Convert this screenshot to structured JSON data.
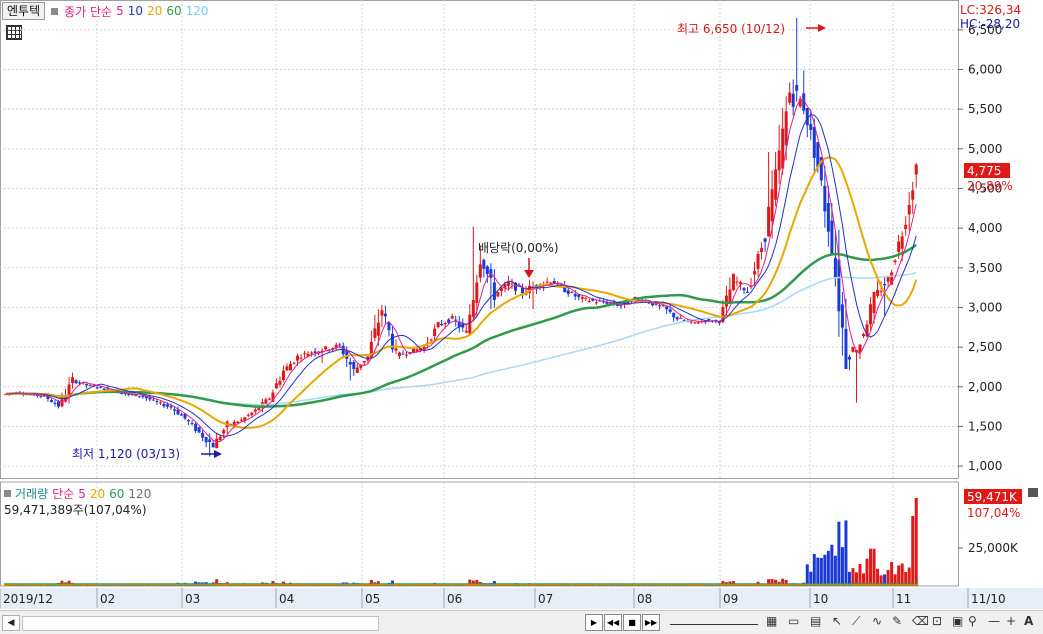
{
  "header": {
    "stock_name": "엔투텍",
    "ma_label": "종가 단순",
    "ma_periods": [
      "5",
      "10",
      "20",
      "60",
      "120"
    ],
    "ma_colors": [
      "#e0208c",
      "#2030c8",
      "#e8a800",
      "#2e9a4a",
      "#80c8f0"
    ]
  },
  "annotations": {
    "high": "최고 6,650 (10/12)",
    "low": "최저 1,120 (03/13)",
    "dividend": "배당락(0,00%)",
    "lc": "LC:326,34",
    "hc": "HC:-28,20",
    "price_tag": "4,775",
    "change_tag": "20,89%"
  },
  "volume_panel": {
    "title": "거래량",
    "ma_label": "단순",
    "ma_periods": [
      "5",
      "20",
      "60",
      "120"
    ],
    "ma_colors": [
      "#e0208c",
      "#e8a800",
      "#2e9a4a",
      "#707070"
    ],
    "value_text": "59,471,389주(107,04%)",
    "tag_value": "59,471K",
    "tag_pct": "107,04%",
    "axis_label": "25,000K"
  },
  "chart_data": {
    "type": "candlestick",
    "x_axis_labels": [
      "2019/12",
      "02",
      "03",
      "04",
      "05",
      "06",
      "07",
      "08",
      "09",
      "10",
      "11",
      "11/10"
    ],
    "y_ticks": [
      "1,000",
      "1,500",
      "2,000",
      "2,500",
      "3,000",
      "3,500",
      "4,000",
      "4,500",
      "5,000",
      "5,500",
      "6,000",
      "6,500"
    ],
    "y_range": [
      850,
      6750
    ],
    "ohlc_weekly_approx": [
      [
        1900,
        1960,
        1870,
        1930
      ],
      [
        1930,
        1980,
        1880,
        1900
      ],
      [
        1900,
        1950,
        1840,
        1880
      ],
      [
        1880,
        1920,
        1720,
        1760
      ],
      [
        1760,
        2180,
        1740,
        2080
      ],
      [
        2080,
        2120,
        1960,
        2020
      ],
      [
        2020,
        2060,
        1950,
        1990
      ],
      [
        1990,
        2020,
        1880,
        1940
      ],
      [
        1940,
        1980,
        1860,
        1900
      ],
      [
        1900,
        1950,
        1830,
        1880
      ],
      [
        1880,
        1920,
        1760,
        1800
      ],
      [
        1800,
        1850,
        1700,
        1740
      ],
      [
        1740,
        1780,
        1560,
        1600
      ],
      [
        1600,
        1640,
        1380,
        1420
      ],
      [
        1420,
        1460,
        1120,
        1260
      ],
      [
        1260,
        1580,
        1220,
        1520
      ],
      [
        1520,
        1640,
        1480,
        1580
      ],
      [
        1580,
        1760,
        1540,
        1700
      ],
      [
        1700,
        1900,
        1660,
        1860
      ],
      [
        1860,
        2280,
        1820,
        2200
      ],
      [
        2200,
        2420,
        2120,
        2380
      ],
      [
        2380,
        2500,
        2280,
        2440
      ],
      [
        2440,
        2560,
        2300,
        2480
      ],
      [
        2480,
        2600,
        2360,
        2520
      ],
      [
        2520,
        2560,
        2080,
        2200
      ],
      [
        2200,
        2420,
        2160,
        2380
      ],
      [
        2380,
        3080,
        2340,
        2980
      ],
      [
        2980,
        3050,
        2340,
        2400
      ],
      [
        2400,
        2520,
        2320,
        2440
      ],
      [
        2440,
        2560,
        2360,
        2500
      ],
      [
        2500,
        2820,
        2460,
        2780
      ],
      [
        2780,
        2920,
        2660,
        2860
      ],
      [
        2860,
        2960,
        2600,
        2680
      ],
      [
        2680,
        4020,
        2640,
        3680
      ],
      [
        3680,
        3720,
        2980,
        3160
      ],
      [
        3160,
        3400,
        3060,
        3300
      ],
      [
        3300,
        3420,
        3100,
        3200
      ],
      [
        3200,
        3360,
        2980,
        3280
      ],
      [
        3280,
        3400,
        3120,
        3340
      ],
      [
        3340,
        3420,
        3160,
        3220
      ],
      [
        3220,
        3300,
        3060,
        3120
      ],
      [
        3120,
        3200,
        3000,
        3080
      ],
      [
        3080,
        3160,
        2980,
        3060
      ],
      [
        3060,
        3120,
        2960,
        3020
      ],
      [
        3020,
        3180,
        2980,
        3120
      ],
      [
        3120,
        3160,
        3020,
        3060
      ],
      [
        3060,
        3140,
        2920,
        3000
      ],
      [
        3000,
        3060,
        2800,
        2860
      ],
      [
        2860,
        2940,
        2720,
        2800
      ],
      [
        2800,
        2880,
        2740,
        2840
      ],
      [
        2840,
        2900,
        2760,
        2820
      ],
      [
        2820,
        3420,
        2800,
        3360
      ],
      [
        3360,
        3460,
        3120,
        3200
      ],
      [
        3200,
        3820,
        3180,
        3760
      ],
      [
        3760,
        4960,
        3700,
        4620
      ],
      [
        4620,
        5960,
        4560,
        5720
      ],
      [
        5720,
        6650,
        5420,
        5560
      ],
      [
        5560,
        5600,
        4700,
        4780
      ],
      [
        4780,
        4820,
        3680,
        3780
      ],
      [
        3780,
        3980,
        2280,
        2380
      ],
      [
        2380,
        2460,
        1800,
        2560
      ],
      [
        2560,
        3200,
        2520,
        3120
      ],
      [
        3120,
        3400,
        2900,
        3360
      ],
      [
        3360,
        3960,
        3280,
        3950
      ],
      [
        3950,
        4820,
        3900,
        4775
      ]
    ],
    "volume_max_label": "59,471K"
  }
}
